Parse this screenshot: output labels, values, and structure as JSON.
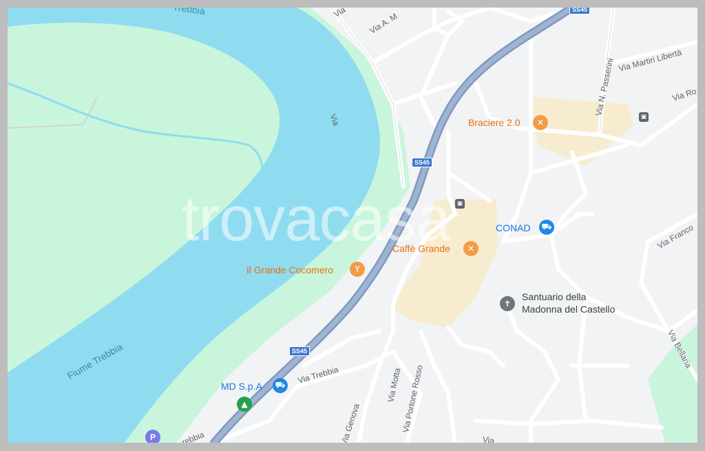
{
  "watermark": "trovacasa",
  "water": {
    "river_top": "Trebbia",
    "river_main": "Fiume Trebbia"
  },
  "highway_shields": [
    "SS45",
    "SS45",
    "SS45"
  ],
  "streets": {
    "via_am": "Via A. M",
    "via_top": "Via",
    "via_mid": "Via",
    "via_martiri": "Via Martiri Libertà",
    "via_passerini": "Via N. Passerini",
    "via_ro": "Via Ro",
    "via_franco": "Via Franco",
    "via_bellaria": "Via Bellaria",
    "via_trebbia": "Via Trebbia",
    "via_trebbia_bottom": "rebbia",
    "via_genova": "Via Genova",
    "via_motta": "Via Motta",
    "via_portone": "Via Portone Rosso",
    "via_bottom": "Via"
  },
  "pois": {
    "braciere": {
      "name": "Braciere 2.0",
      "icon": "restaurant-icon",
      "color": "#e8710a"
    },
    "caffe": {
      "name": "Caffè Grande",
      "icon": "restaurant-icon",
      "color": "#e8710a"
    },
    "cocomero": {
      "name": "Il Grande Cocomero",
      "icon": "bar-icon",
      "color": "#e8710a"
    },
    "conad": {
      "name": "CONAD",
      "icon": "shopping-cart-icon",
      "color": "#1a73e8"
    },
    "santuario": {
      "name_line1": "Santuario della",
      "name_line2": "Madonna del Castello",
      "icon": "church-cross-icon",
      "color": "#3c4043"
    },
    "md": {
      "name": "MD S.p.A",
      "icon": "shopping-cart-icon",
      "color": "#1a73e8"
    },
    "campground": {
      "icon": "campground-icon",
      "color": "#24a148"
    },
    "parking": {
      "label": "P",
      "icon": "parking-icon",
      "color": "#7b79e8"
    }
  },
  "colors": {
    "water": "#8fdcf0",
    "park": "#c9f5dc",
    "highway": "#8aa4c6",
    "commercial": "#f8ecd0",
    "background": "#f1f3f4"
  }
}
